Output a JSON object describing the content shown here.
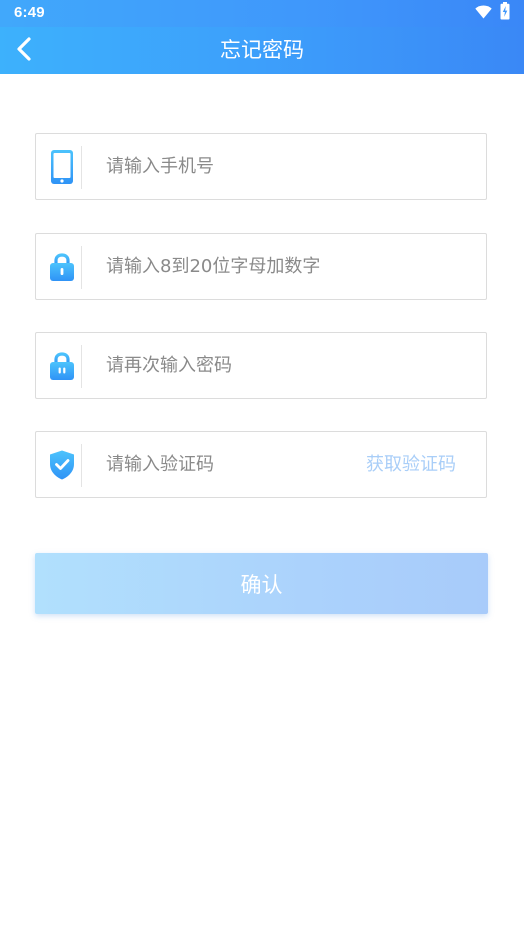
{
  "status_bar": {
    "time": "6:49",
    "icons": [
      "wifi-icon",
      "battery-icon"
    ]
  },
  "header": {
    "title": "忘记密码",
    "back_icon": "chevron-left-icon"
  },
  "form": {
    "phone": {
      "placeholder": "请输入手机号",
      "value": "",
      "icon": "phone-icon"
    },
    "password": {
      "placeholder": "请输入8到20位字母加数字",
      "value": "",
      "icon": "lock-icon"
    },
    "confirm_password": {
      "placeholder": "请再次输入密码",
      "value": "",
      "icon": "lock-icon"
    },
    "verification_code": {
      "placeholder": "请输入验证码",
      "value": "",
      "icon": "shield-check-icon",
      "get_code_label": "获取验证码"
    },
    "confirm_label": "确认"
  },
  "colors": {
    "header_start": "#3db1fc",
    "header_end": "#3a88f6",
    "button_start": "#b1e0fd",
    "button_end": "#a8cbfa",
    "get_code_text": "#a9cef8",
    "placeholder_text": "#8a8a8a",
    "border": "#dcdcdc"
  }
}
